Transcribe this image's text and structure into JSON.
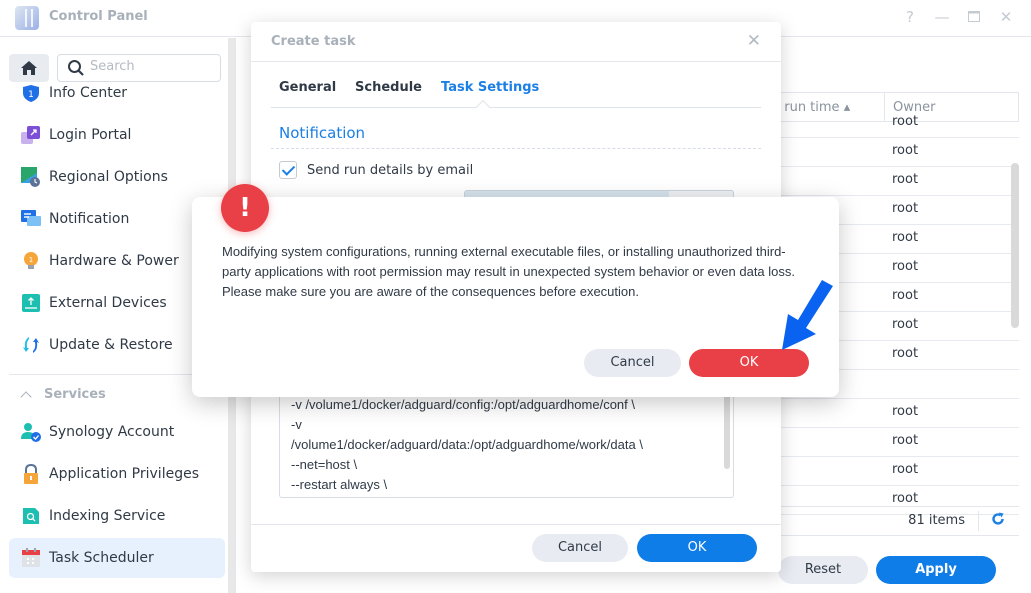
{
  "window": {
    "title": "Control Panel",
    "controls": [
      "help-icon",
      "minimize-icon",
      "maximize-icon",
      "close-icon"
    ],
    "help_glyph": "?",
    "minimize_glyph": "—",
    "maximize_glyph": "▭",
    "close_glyph": "✕"
  },
  "sidebar": {
    "search_placeholder": "Search",
    "items": [
      {
        "label": "Info Center",
        "icon": "info-shield-icon"
      },
      {
        "label": "Login Portal",
        "icon": "login-portal-icon"
      },
      {
        "label": "Regional Options",
        "icon": "regional-options-icon"
      },
      {
        "label": "Notification",
        "icon": "notification-icon"
      },
      {
        "label": "Hardware & Power",
        "icon": "lightbulb-icon"
      },
      {
        "label": "External Devices",
        "icon": "external-device-icon"
      },
      {
        "label": "Update & Restore",
        "icon": "update-restore-icon"
      }
    ],
    "section_label": "Services",
    "service_items": [
      {
        "label": "Synology Account",
        "icon": "synology-account-icon"
      },
      {
        "label": "Application Privileges",
        "icon": "lock-icon"
      },
      {
        "label": "Indexing Service",
        "icon": "indexing-icon"
      },
      {
        "label": "Task Scheduler",
        "icon": "calendar-icon",
        "active": true
      }
    ]
  },
  "table": {
    "columns": [
      {
        "label": "Next run time ▴",
        "visible_label": "t run time ▴"
      },
      {
        "label": "Owner"
      }
    ],
    "rows": [
      "root",
      "root",
      "root",
      "root",
      "root",
      "root",
      "root",
      "root",
      "root",
      "",
      "root",
      "root",
      "root",
      "root"
    ],
    "item_count": "81 items",
    "refresh_glyph": "↻"
  },
  "bottom_buttons": {
    "reset": "Reset",
    "apply": "Apply"
  },
  "create_task_dialog": {
    "title": "Create task",
    "close_glyph": "✕",
    "tabs": [
      {
        "label": "General"
      },
      {
        "label": "Schedule"
      },
      {
        "label": "Task Settings",
        "active": true
      }
    ],
    "section_title": "Notification",
    "send_email_label": "Send run details by email",
    "send_email_checked": true,
    "script_lines": [
      "-v /volume1/docker/adguard/config:/opt/adguardhome/conf \\",
      "-v",
      "/volume1/docker/adguard/data:/opt/adguardhome/work/data \\",
      "--net=host \\",
      "--restart always \\"
    ],
    "cancel": "Cancel",
    "ok": "OK"
  },
  "warning_dialog": {
    "icon_glyph": "!",
    "message": "Modifying system configurations, running external executable files, or installing unauthorized third-party applications with root permission may result in unexpected system behavior or even data loss. Please make sure you are aware of the consequences before execution.",
    "cancel": "Cancel",
    "ok": "OK"
  },
  "colors": {
    "accent_blue": "#1b7fe6",
    "primary_button": "#0f7de8",
    "danger": "#e84046",
    "annotation_arrow": "#0a63f0"
  }
}
